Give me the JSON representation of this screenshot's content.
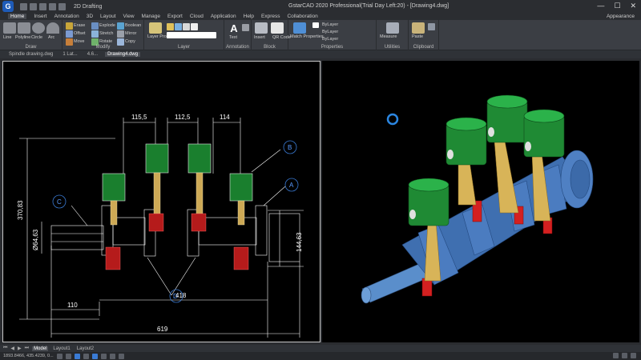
{
  "titlebar": {
    "workspace": "2D Drafting",
    "title": "GstarCAD 2020 Professional(Trial Day Left:20) - [Drawing4.dwg]",
    "minimize": "—",
    "maximize": "☐",
    "close": "✕"
  },
  "menu": {
    "tabs": [
      "Home",
      "Insert",
      "Annotation",
      "3D",
      "Layout",
      "View",
      "Manage",
      "Export",
      "Cloud",
      "Application",
      "Help",
      "Express",
      "Collaboration"
    ],
    "appearance": "Appearance"
  },
  "ribbon": {
    "draw": {
      "label": "Draw",
      "line": "Line",
      "polyline": "Polyline",
      "circle": "Circle",
      "arc": "Arc"
    },
    "modify": {
      "label": "Modify",
      "items": [
        "Erase",
        "Explode",
        "Boolean",
        "Offset",
        "Stretch",
        "Mirror",
        "Move",
        "Rotate",
        "Copy"
      ]
    },
    "layer": {
      "label": "Layer",
      "properties": "Layer Properties"
    },
    "annotation": {
      "label": "Annotation",
      "text": "Text"
    },
    "block": {
      "label": "Block",
      "insert": "Insert",
      "qr": "QR Code"
    },
    "properties": {
      "label": "Properties",
      "match": "Match Properties",
      "bylayer1": "ByLayer",
      "bylayer2": "ByLayer",
      "bylayer3": "ByLayer"
    },
    "utilities": {
      "label": "Utilities",
      "measure": "Measure"
    },
    "clipboard": {
      "label": "Clipboard",
      "paste": "Paste"
    }
  },
  "doc_tabs": [
    "Spindle drawing.dwg",
    "1 Lat...",
    "4.6...",
    "Drawing4.dwg"
  ],
  "drawing": {
    "dims": {
      "d1": "115,5",
      "d2": "112,5",
      "d3": "114",
      "height": "370,83",
      "diam": "Ø64,63",
      "right": "144,63",
      "bottom1": "110",
      "bottom2": "418",
      "bottom3": "619"
    },
    "callouts": {
      "a": "A",
      "b": "B",
      "c": "C",
      "d": "D"
    }
  },
  "layout_tabs": [
    "Model",
    "Layout1",
    "Layout2"
  ],
  "status": {
    "coords": "1893.8466, 435.4239, 0..."
  },
  "colors": {
    "piston": "#2e9e3f",
    "rod": "#d8b458",
    "crank": "#3f6fb0",
    "pin": "#d62020"
  }
}
